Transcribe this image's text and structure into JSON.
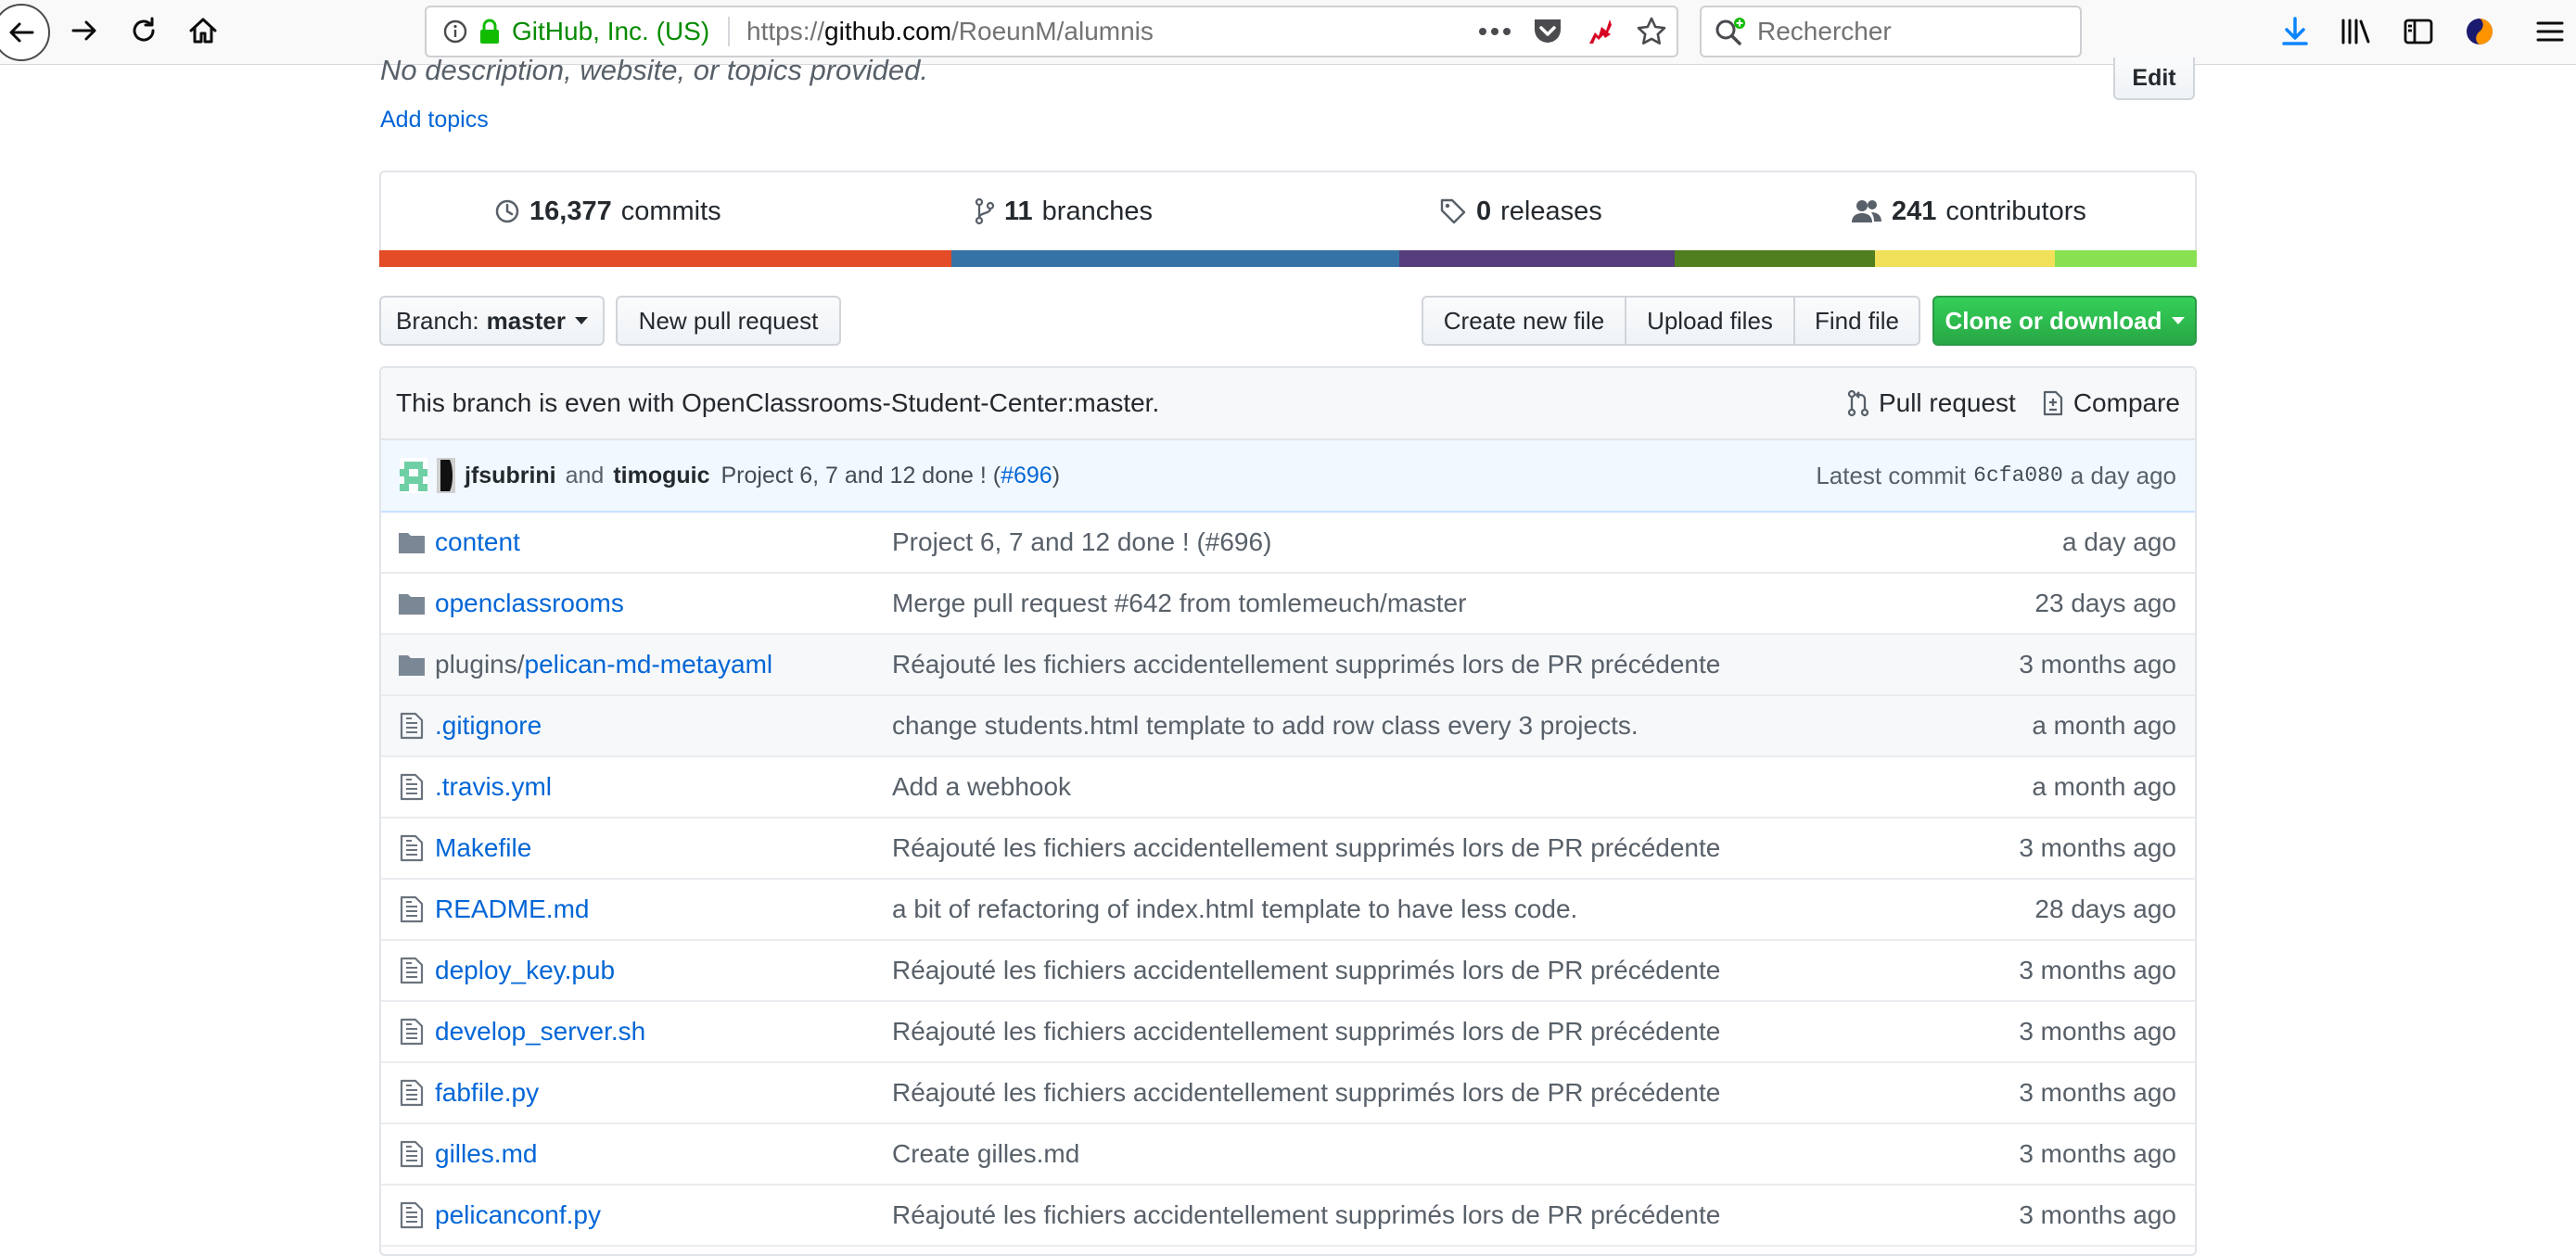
{
  "browser": {
    "identity": "GitHub, Inc. (US)",
    "url_scheme": "https://",
    "url_host": "github.com",
    "url_path": "/RoeunM/alumnis",
    "search_placeholder": "Rechercher"
  },
  "repo": {
    "description": "No description, website, or topics provided.",
    "add_topics": "Add topics",
    "edit_label": "Edit"
  },
  "numbers": {
    "commits_count": "16,377",
    "commits_label": "commits",
    "branches_count": "11",
    "branches_label": "branches",
    "releases_count": "0",
    "releases_label": "releases",
    "contributors_count": "241",
    "contributors_label": "contributors"
  },
  "language_bar": [
    {
      "color": "#e34c26",
      "share": 31.5
    },
    {
      "color": "#3572a5",
      "share": 24.6
    },
    {
      "color": "#563d7c",
      "share": 15.2
    },
    {
      "color": "#4f7f1e",
      "share": 11.0
    },
    {
      "color": "#f1e05a",
      "share": 9.9
    },
    {
      "color": "#89e051",
      "share": 7.8
    }
  ],
  "toolbar": {
    "branch_prefix": "Branch:",
    "branch_name": "master",
    "new_pull_request": "New pull request",
    "create_new_file": "Create new file",
    "upload_files": "Upload files",
    "find_file": "Find file",
    "clone_or_download": "Clone or download"
  },
  "branch_info": {
    "message": "This branch is even with OpenClassrooms-Student-Center:master.",
    "pull_request": "Pull request",
    "compare": "Compare"
  },
  "latest_commit": {
    "author1": "jfsubrini",
    "and": "and",
    "author2": "timoguic",
    "message": "Project 6, 7 and 12 done ! (",
    "pr": "#696",
    "close_paren": ")",
    "latest_label": "Latest commit",
    "sha": "6cfa080",
    "age": "a day ago"
  },
  "files": [
    {
      "type": "dir",
      "prefix": "",
      "name": "content",
      "message": "Project 6, 7 and 12 done ! (#696)",
      "age": "a day ago"
    },
    {
      "type": "dir",
      "prefix": "",
      "name": "openclassrooms",
      "message": "Merge pull request #642 from tomlemeuch/master",
      "age": "23 days ago"
    },
    {
      "type": "dir",
      "prefix": "plugins/",
      "name": "pelican-md-metayaml",
      "message": "Réajouté les fichiers accidentellement supprimés lors de PR précédente",
      "age": "3 months ago"
    },
    {
      "type": "file",
      "prefix": "",
      "name": ".gitignore",
      "message": "change students.html template to add row class every 3 projects.",
      "age": "a month ago"
    },
    {
      "type": "file",
      "prefix": "",
      "name": ".travis.yml",
      "message": "Add a webhook",
      "age": "a month ago"
    },
    {
      "type": "file",
      "prefix": "",
      "name": "Makefile",
      "message": "Réajouté les fichiers accidentellement supprimés lors de PR précédente",
      "age": "3 months ago"
    },
    {
      "type": "file",
      "prefix": "",
      "name": "README.md",
      "message": "a bit of refactoring of index.html template to have less code.",
      "age": "28 days ago"
    },
    {
      "type": "file",
      "prefix": "",
      "name": "deploy_key.pub",
      "message": "Réajouté les fichiers accidentellement supprimés lors de PR précédente",
      "age": "3 months ago"
    },
    {
      "type": "file",
      "prefix": "",
      "name": "develop_server.sh",
      "message": "Réajouté les fichiers accidentellement supprimés lors de PR précédente",
      "age": "3 months ago"
    },
    {
      "type": "file",
      "prefix": "",
      "name": "fabfile.py",
      "message": "Réajouté les fichiers accidentellement supprimés lors de PR précédente",
      "age": "3 months ago"
    },
    {
      "type": "file",
      "prefix": "",
      "name": "gilles.md",
      "message": "Create gilles.md",
      "age": "3 months ago"
    },
    {
      "type": "file",
      "prefix": "",
      "name": "pelicanconf.py",
      "message": "Réajouté les fichiers accidentellement supprimés lors de PR précédente",
      "age": "3 months ago"
    }
  ]
}
